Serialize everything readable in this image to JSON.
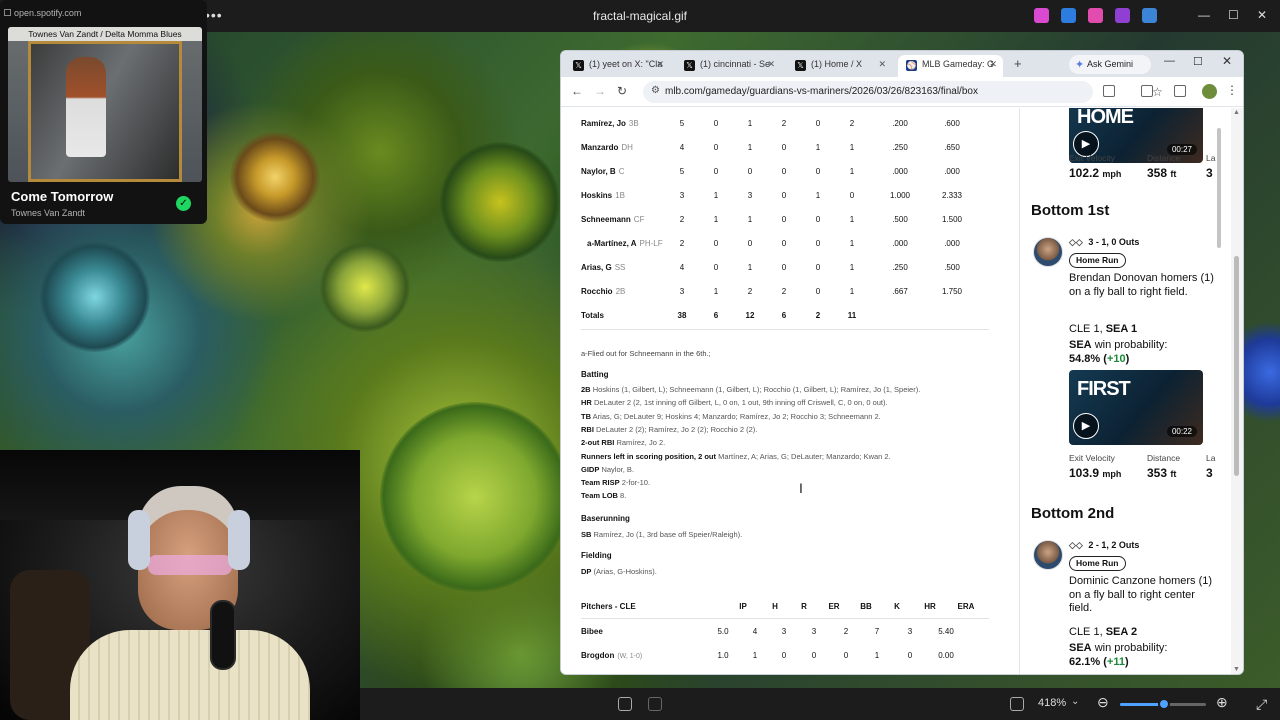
{
  "viewer": {
    "title": "fractal-magical.gif",
    "zoom": "418%",
    "zoom_fraction": 0.5,
    "controls": {
      "minimize": "—",
      "maximize": "☐",
      "close": "✕",
      "more": "•••"
    }
  },
  "spotify": {
    "url": "open.spotify.com",
    "album_caption": "Townes Van Zandt / Delta Momma Blues",
    "track_title": "Come Tomorrow",
    "artist": "Townes Van Zandt",
    "saved_icon": "✓"
  },
  "browser": {
    "tabs": [
      {
        "label": "(1) yeet on X: \"Cla",
        "icon": "x-logo"
      },
      {
        "label": "(1) cincinnati - Se",
        "icon": "x-logo"
      },
      {
        "label": "(1) Home / X",
        "icon": "x-logo"
      },
      {
        "label": "MLB Gameday: G",
        "icon": "mlb-logo",
        "active": true
      }
    ],
    "new_tab": "+",
    "gemini_label": "Ask Gemini",
    "url": "mlb.com/gameday/guardians-vs-mariners/2026/03/26/823163/final/box",
    "nav": {
      "back": "←",
      "forward": "→",
      "reload": "↻"
    }
  },
  "boxscore": {
    "batters": [
      {
        "name": "Ramírez, Jo",
        "pos": "3B",
        "stats": [
          "5",
          "0",
          "1",
          "2",
          "0",
          "2",
          ".200",
          ".600"
        ]
      },
      {
        "name": "Manzardo",
        "pos": "DH",
        "stats": [
          "4",
          "0",
          "1",
          "0",
          "1",
          "1",
          ".250",
          ".650"
        ]
      },
      {
        "name": "Naylor, B",
        "pos": "C",
        "stats": [
          "5",
          "0",
          "0",
          "0",
          "0",
          "1",
          ".000",
          ".000"
        ]
      },
      {
        "name": "Hoskins",
        "pos": "1B",
        "stats": [
          "3",
          "1",
          "3",
          "0",
          "1",
          "0",
          "1.000",
          "2.333"
        ]
      },
      {
        "name": "Schneemann",
        "pos": "CF",
        "stats": [
          "2",
          "1",
          "1",
          "0",
          "0",
          "1",
          ".500",
          "1.500"
        ]
      },
      {
        "name": "a-Martínez, A",
        "pos": "PH-LF",
        "stats": [
          "2",
          "0",
          "0",
          "0",
          "0",
          "1",
          ".000",
          ".000"
        ]
      },
      {
        "name": "Arias, G",
        "pos": "SS",
        "stats": [
          "4",
          "0",
          "1",
          "0",
          "0",
          "1",
          ".250",
          ".500"
        ]
      },
      {
        "name": "Rocchio",
        "pos": "2B",
        "stats": [
          "3",
          "1",
          "2",
          "2",
          "0",
          "1",
          ".667",
          "1.750"
        ]
      }
    ],
    "totals": {
      "label": "Totals",
      "stats": [
        "38",
        "6",
        "12",
        "6",
        "2",
        "11"
      ]
    },
    "footnote": "a-Flied out for Schneemann in the 6th.;",
    "batting_head": "Batting",
    "batting": [
      {
        "k": "2B",
        "v": "Hoskins (1, Gilbert, L); Schneemann (1, Gilbert, L); Rocchio (1, Gilbert, L); Ramírez, Jo (1, Speier)."
      },
      {
        "k": "HR",
        "v": "DeLauter 2 (2, 1st inning off Gilbert, L, 0 on, 1 out, 9th inning off Criswell, C, 0 on, 0 out)."
      },
      {
        "k": "TB",
        "v": "Arias, G; DeLauter 9; Hoskins 4; Manzardo; Ramírez, Jo 2; Rocchio 3; Schneemann 2."
      },
      {
        "k": "RBI",
        "v": "DeLauter 2 (2); Ramírez, Jo 2 (2); Rocchio 2 (2)."
      },
      {
        "k": "2-out RBI",
        "v": "Ramírez, Jo 2."
      },
      {
        "k": "Runners left in scoring position, 2 out",
        "v": "Martínez, A; Arias, G; DeLauter; Manzardo; Kwan 2."
      },
      {
        "k": "GIDP",
        "v": "Naylor, B."
      },
      {
        "k": "Team RISP",
        "v": "2-for-10."
      },
      {
        "k": "Team LOB",
        "v": "8."
      }
    ],
    "baserunning_head": "Baserunning",
    "baserunning": [
      {
        "k": "SB",
        "v": "Ramírez, Jo (1, 3rd base off Speier/Raleigh)."
      }
    ],
    "fielding_head": "Fielding",
    "fielding": [
      {
        "k": "DP",
        "v": "(Arias, G-Hoskins)."
      }
    ],
    "pitchers_head": "Pitchers - CLE",
    "pitcher_cols": [
      "IP",
      "H",
      "R",
      "ER",
      "BB",
      "K",
      "HR",
      "ERA"
    ],
    "pitchers": [
      {
        "name": "Bibee",
        "dec": "",
        "stats": [
          "5.0",
          "4",
          "3",
          "3",
          "2",
          "7",
          "3",
          "5.40"
        ]
      },
      {
        "name": "Brogdon",
        "dec": "(W, 1-0)",
        "stats": [
          "1.0",
          "1",
          "0",
          "0",
          "0",
          "1",
          "0",
          "0.00"
        ]
      }
    ]
  },
  "plays": {
    "top_clip": {
      "duration": "00:27",
      "exit_velocity_label": "Exit Velocity",
      "exit_velocity": "102.2",
      "ev_unit": "mph",
      "distance_label": "Distance",
      "distance": "358",
      "distance_unit": "ft",
      "extra_label": "La",
      "extra_val": "3"
    },
    "innings": [
      {
        "title": "Bottom 1st",
        "count": "3 - 1, 0 Outs",
        "badge": "Home Run",
        "desc": "Brendan Donovan homers (1) on a fly ball to right field.",
        "score_away": "CLE 1,",
        "score_home": "SEA 1",
        "wp_team": "SEA",
        "wp_text": "win probability:",
        "wp_value": "54.8%",
        "wp_delta": "+10",
        "clip": {
          "overlay": "FIRST",
          "duration": "00:22"
        },
        "exit_velocity_label": "Exit Velocity",
        "exit_velocity": "103.9",
        "ev_unit": "mph",
        "distance_label": "Distance",
        "distance": "353",
        "distance_unit": "ft",
        "extra_label": "La",
        "extra_val": "3"
      },
      {
        "title": "Bottom 2nd",
        "count": "2 - 1, 2 Outs",
        "badge": "Home Run",
        "desc": "Dominic Canzone homers (1) on a fly ball to right center field.",
        "score_away": "CLE 1,",
        "score_home": "SEA 2",
        "wp_team": "SEA",
        "wp_text": "win probability:",
        "wp_value": "62.1%",
        "wp_delta": "+11"
      }
    ]
  },
  "colors": {
    "accent": "#4da3ff",
    "spotify_green": "#1ed760",
    "wp_positive": "#1a8a3a"
  }
}
